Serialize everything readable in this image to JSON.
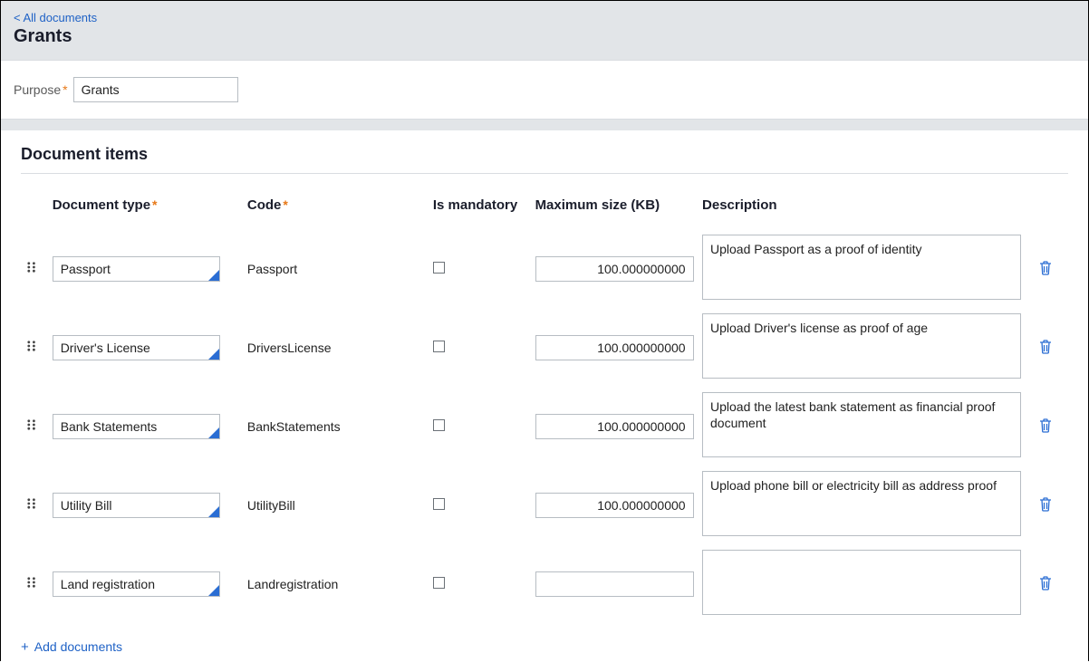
{
  "header": {
    "back_link": "< All documents",
    "title": "Grants"
  },
  "purpose": {
    "label": "Purpose",
    "value": "Grants"
  },
  "items": {
    "section_title": "Document items",
    "columns": {
      "document_type": "Document type",
      "code": "Code",
      "is_mandatory": "Is mandatory",
      "max_size": "Maximum size (KB)",
      "description": "Description"
    },
    "rows": [
      {
        "document_type": "Passport",
        "code": "Passport",
        "is_mandatory": false,
        "max_size": "100.000000000",
        "description": "Upload Passport as a proof of identity"
      },
      {
        "document_type": "Driver's License",
        "code": "DriversLicense",
        "is_mandatory": false,
        "max_size": "100.000000000",
        "description": "Upload Driver's license as proof of age"
      },
      {
        "document_type": "Bank Statements",
        "code": "BankStatements",
        "is_mandatory": false,
        "max_size": "100.000000000",
        "description": "Upload the latest bank statement as financial proof document"
      },
      {
        "document_type": "Utility Bill",
        "code": "UtilityBill",
        "is_mandatory": false,
        "max_size": "100.000000000",
        "description": "Upload phone bill or electricity bill as address proof"
      },
      {
        "document_type": "Land registration",
        "code": "Landregistration",
        "is_mandatory": false,
        "max_size": "",
        "description": ""
      }
    ],
    "add_label": "Add documents"
  }
}
